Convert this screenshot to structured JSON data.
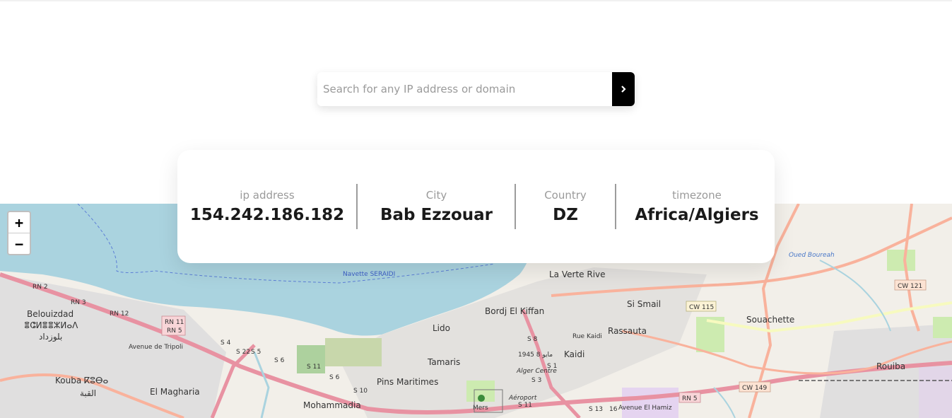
{
  "search": {
    "placeholder": "Search for any IP address or domain",
    "submit_icon": "chevron-right-icon"
  },
  "info": {
    "ip_label": "ip address",
    "ip_value": "154.242.186.182",
    "city_label": "City",
    "city_value": "Bab Ezzouar",
    "country_label": "Country",
    "country_value": "DZ",
    "timezone_label": "timezone",
    "timezone_value": "Africa/Algiers"
  },
  "map": {
    "zoom_in": "+",
    "zoom_out": "−",
    "labels": {
      "la_verte_rive": "La Verte Rive",
      "bordj_el_kiffan": "Bordj El Kiffan",
      "si_smail": "Si Smail",
      "rassauta": "Rassauta",
      "souachette": "Souachette",
      "rouiba": "Rouiba",
      "lido": "Lido",
      "kaidi": "Kaidi",
      "tamaris": "Tamaris",
      "pins_maritimes": "Pins Maritimes",
      "mohammadia": "Mohammadia",
      "el_magharia": "El Magharia",
      "belouizdad": "Belouizdad",
      "belouizdad_tifinagh": "ⴻⵛⵍⴻⴻⵣⵍⴰⴷ",
      "belouizdad_ar": "بلوزداد",
      "kouba": "Kouba ⴽⵓⴱⴰ",
      "kouba_ar": "القبة",
      "alger_centre": "Alger Centre",
      "aeroport": "Aéroport",
      "navette": "Navette SERAIDI",
      "oued_boureah": "Oued Boureah",
      "avenue_tripoli": "Avenue de Tripoli",
      "avenue_el_hamiz": "Avenue El Hamiz",
      "rue_kaidi": "Rue Kaidi",
      "mars_1945": "1945 مايو 8",
      "rn11": "RN 11",
      "rn5": "RN 5",
      "rn5b": "RN 5",
      "rn2": "RN 2",
      "rn3": "RN 3",
      "rn12": "RN 12",
      "cw115": "CW 115",
      "cw121": "CW 121",
      "cw149": "CW 149",
      "s4": "S 4",
      "s5": "S 5",
      "s6": "S 6",
      "s7": "S 6",
      "s8": "S 8",
      "s10": "S 10",
      "s11": "S 11",
      "s13": "S 13",
      "s22": "S 22",
      "s1": "S 1",
      "s3": "S 3",
      "n16": "16",
      "mers": "Mers"
    },
    "colors": {
      "sea": "#aad3df",
      "land": "#f2efe9",
      "urban": "#e0dfdf",
      "main_road": "#e892a2",
      "secondary_road": "#f9b29c",
      "tertiary_road": "#f7fabf",
      "park": "#cdebb0"
    }
  }
}
